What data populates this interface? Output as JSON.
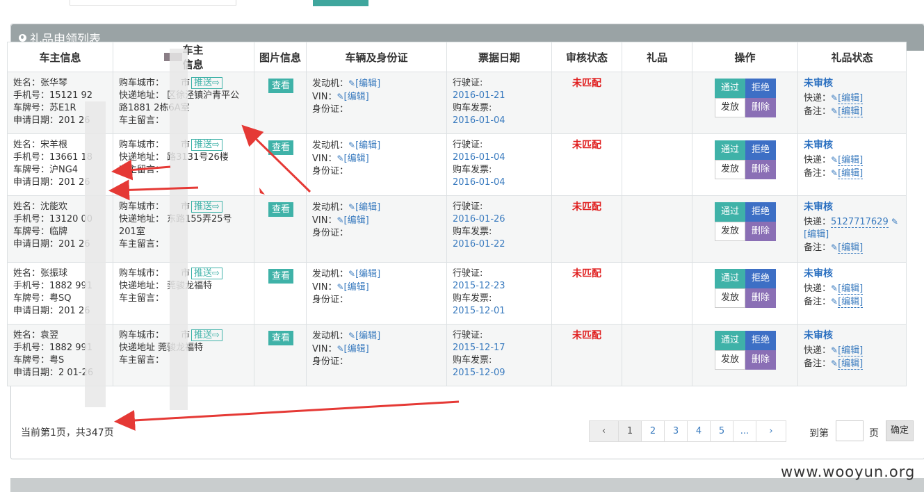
{
  "panel": {
    "title": "礼品申领列表"
  },
  "columns": [
    "车主信息",
    "车主信息",
    "图片信息",
    "车辆及身份证",
    "票据日期",
    "审核状态",
    "礼品",
    "操作",
    "礼品状态"
  ],
  "labels": {
    "look": "查看",
    "push": "推送",
    "engine": "发动机：",
    "vin": "VIN：",
    "idcard": "身份证：",
    "edit": "[编辑]",
    "license": "行驶证:",
    "invoice": "购车发票:",
    "pass": "通过",
    "reject": "拒绝",
    "issue": "发放",
    "delete": "删除",
    "express": "快递：",
    "remark": "备注：",
    "unmatched": "未匹配",
    "unaudited": "未审核"
  },
  "rows": [
    {
      "name": "姓名：张华琴",
      "phone": "手机号：15121    92",
      "plate": "车牌号：苏E1R",
      "apply_date": "申请日期：201      26",
      "city": "购车城市：",
      "city_tail": "市",
      "address": "快递地址：    区徐泾镇沪青平公路1881      2栋6A室",
      "message": "车主留言：",
      "license_date": "2016-01-21",
      "invoice_date": "2016-01-04",
      "express_value": ""
    },
    {
      "name": "姓名：宋羊根",
      "phone": "手机号：13661      18",
      "plate": "车牌号：沪NG4",
      "apply_date": "申请日期：201      26",
      "city": "购车城市：",
      "city_tail": "市",
      "address": "快递地址：    路3131号26楼",
      "message": "车主留言：",
      "license_date": "2016-01-04",
      "invoice_date": "2016-01-04",
      "express_value": ""
    },
    {
      "name": "姓名：沈能欢",
      "phone": "手机号：13120      00",
      "plate": "车牌号：临牌",
      "apply_date": "申请日期：201      26",
      "city": "购车城市：",
      "city_tail": "市",
      "address": "快递地址：    东路155弄25号201室",
      "message": "车主留言：",
      "license_date": "2016-01-26",
      "invoice_date": "2016-01-22",
      "express_value": "5127717629"
    },
    {
      "name": "姓名：张振球",
      "phone": "手机号：1882      991",
      "plate": "车牌号：粤SQ",
      "apply_date": "申请日期：201      26",
      "city": "购车城市：",
      "city_tail": "市",
      "address": "快递地址：    莞骏龙福特",
      "message": "车主留言：",
      "license_date": "2015-12-23",
      "invoice_date": "2015-12-01",
      "express_value": ""
    },
    {
      "name": "姓名：袁翌",
      "phone": "手机号：1882      991",
      "plate": "车牌号：粤S",
      "apply_date": "申请日期：2      01-26",
      "city": "购车城市：",
      "city_tail": "市",
      "address": "快递地址    莞骏龙福特",
      "message": "车主留言：",
      "license_date": "2015-12-17",
      "invoice_date": "2015-12-09",
      "express_value": ""
    }
  ],
  "pager": {
    "summary": "当前第1页，共347页",
    "prev": "‹",
    "pages": [
      "1",
      "2",
      "3",
      "4",
      "5",
      "..."
    ],
    "next": "›",
    "goto_label": "到第",
    "goto_suffix": "页",
    "confirm": "确定"
  },
  "watermark": "www.wooyun.org",
  "colors": {
    "teal": "#3fb2a8",
    "blue": "#3d6fc5",
    "purple": "#8a6fb5",
    "red": "#e02020",
    "header": "#9aa3a5"
  }
}
